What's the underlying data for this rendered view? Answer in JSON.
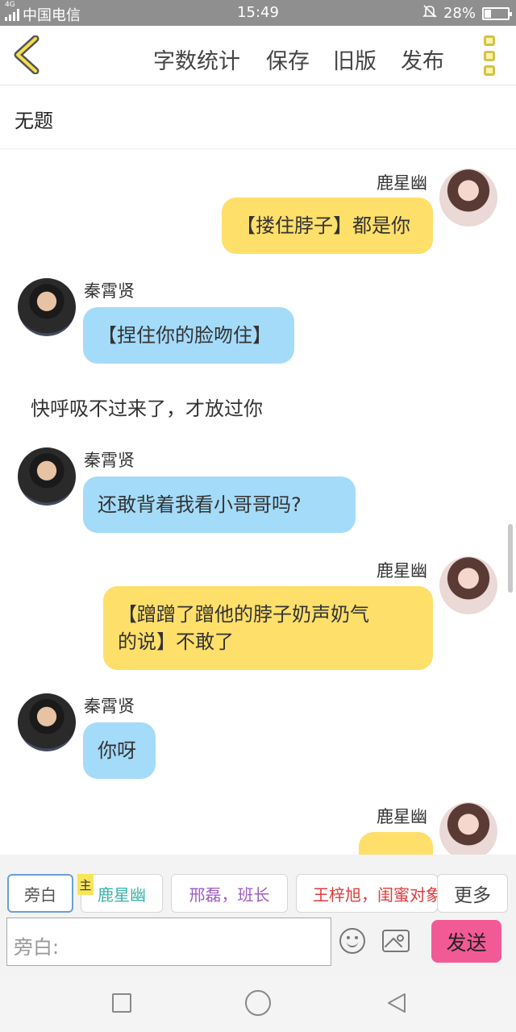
{
  "status_bar": {
    "network": "4G",
    "carrier": "中国电信",
    "time": "15:49",
    "battery_text": "28%",
    "battery_level": 0.28
  },
  "toolbar": {
    "word_count": "字数统计",
    "save": "保存",
    "old_version": "旧版",
    "publish": "发布"
  },
  "document": {
    "title": "无题"
  },
  "messages": [
    {
      "speaker": "鹿星幽",
      "side": "right",
      "color": "yellow",
      "text": "【搂住脖子】都是你"
    },
    {
      "speaker": "秦霄贤",
      "side": "left",
      "color": "blue",
      "text": "【捏住你的脸吻住】"
    },
    {
      "narration": "快呼吸不过来了，才放过你"
    },
    {
      "speaker": "秦霄贤",
      "side": "left",
      "color": "blue",
      "text": "还敢背着我看小哥哥吗?"
    },
    {
      "speaker": "鹿星幽",
      "side": "right",
      "color": "yellow",
      "line1": "【蹭蹭了蹭他的脖子奶声奶气",
      "line2": "的说】不敢了"
    },
    {
      "speaker": "秦霄贤",
      "side": "left",
      "color": "blue",
      "text": "你呀"
    },
    {
      "speaker": "鹿星幽",
      "side": "right",
      "color": "yellow",
      "text": ""
    }
  ],
  "roles": {
    "narration": "旁白",
    "host_tag": "主",
    "role1": "鹿星幽",
    "role2": "邢磊，班长",
    "role3": "王梓旭，闺蜜对象",
    "more": "更多"
  },
  "input": {
    "placeholder": "旁白:",
    "send": "发送"
  },
  "colors": {
    "yellow_bubble": "#fedf6a",
    "blue_bubble": "#a4dbf9",
    "send_button": "#f25a95",
    "role1_text": "#3bb3a8",
    "role2_text": "#a05cc8",
    "role3_text": "#e03b3b"
  }
}
